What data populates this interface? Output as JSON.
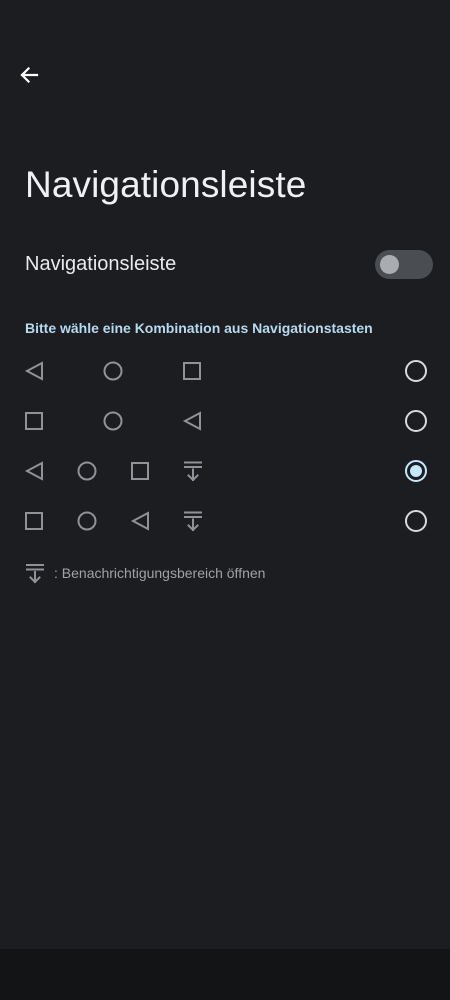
{
  "title": "Navigationsleiste",
  "toggle": {
    "label": "Navigationsleiste",
    "on": false
  },
  "section_header": "Bitte wähle eine Kombination aus Navigationstasten",
  "options": [
    {
      "buttons": [
        "back-icon",
        "home-icon",
        "recents-icon"
      ],
      "selected": false
    },
    {
      "buttons": [
        "recents-icon",
        "home-icon",
        "back-icon"
      ],
      "selected": false
    },
    {
      "buttons": [
        "back-icon",
        "home-icon",
        "recents-icon",
        "notification-pulldown-icon"
      ],
      "selected": true
    },
    {
      "buttons": [
        "recents-icon",
        "home-icon",
        "back-icon",
        "notification-pulldown-icon"
      ],
      "selected": false
    }
  ],
  "legend": {
    "icon": "notification-pulldown-icon",
    "text": ": Benachrichtigungsbereich öffnen"
  },
  "colors": {
    "background": "#1b1d20",
    "accent": "#c6e6fb",
    "icon": "#8f9399"
  }
}
